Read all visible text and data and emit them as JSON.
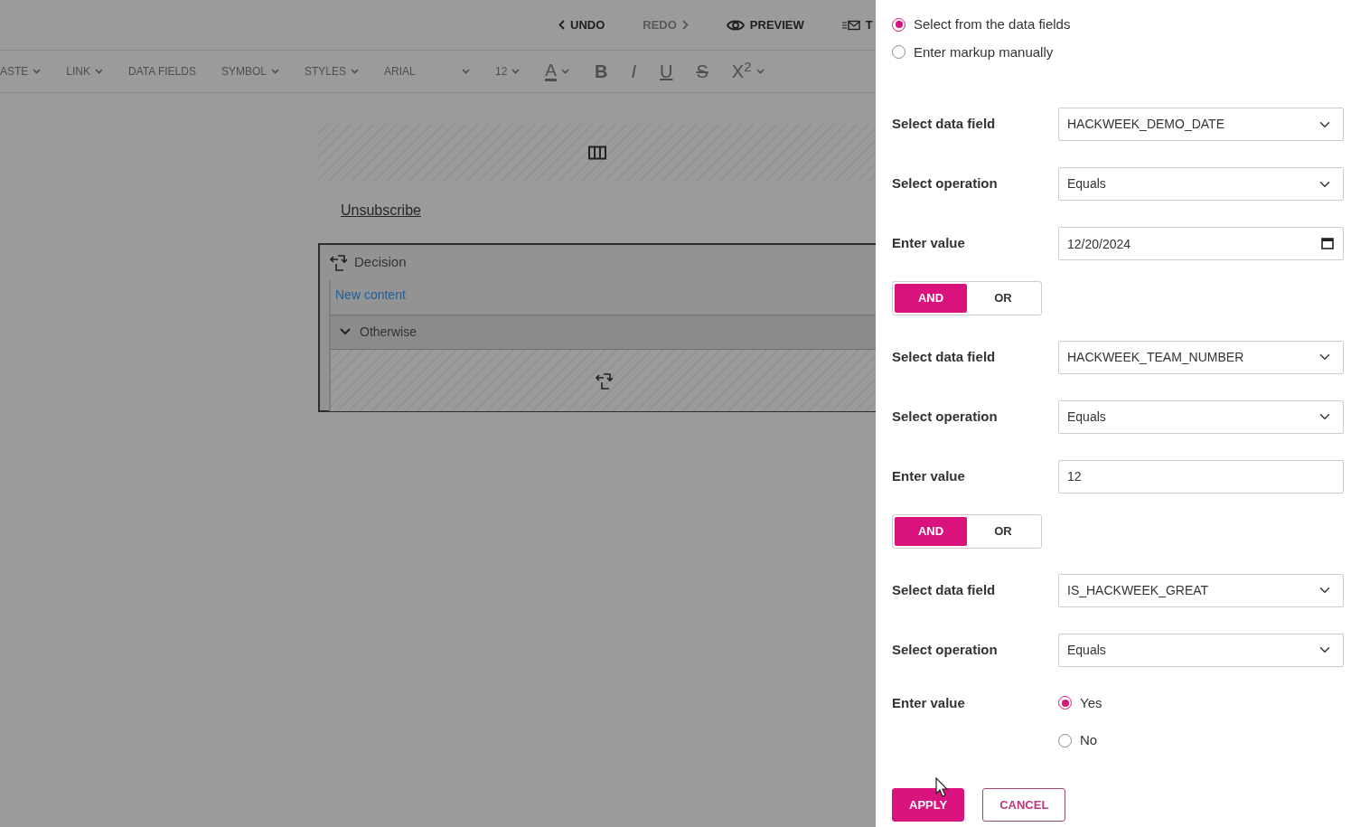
{
  "editor": {
    "history": [
      {
        "kind": "undo",
        "label": "UNDO",
        "disabled": false
      },
      {
        "kind": "redo",
        "label": "REDO",
        "disabled": true
      },
      {
        "kind": "preview",
        "label": "PREVIEW",
        "disabled": false
      },
      {
        "kind": "template",
        "label": "T",
        "disabled": false
      }
    ],
    "toolbar": [
      {
        "kind": "menu",
        "label": "ASTE"
      },
      {
        "kind": "menu",
        "label": "LINK"
      },
      {
        "kind": "plain",
        "label": "DATA FIELDS"
      },
      {
        "kind": "menu",
        "label": "SYMBOL"
      },
      {
        "kind": "menu",
        "label": "STYLES"
      },
      {
        "kind": "font",
        "label": "ARIAL"
      },
      {
        "kind": "menu",
        "label": "12"
      },
      {
        "kind": "color",
        "label": "A"
      },
      {
        "kind": "bold",
        "label": "B"
      },
      {
        "kind": "italic",
        "label": "I"
      },
      {
        "kind": "underline",
        "label": "U"
      },
      {
        "kind": "strike",
        "label": "S"
      },
      {
        "kind": "sup",
        "label": "X$^{2}$"
      }
    ],
    "link": "Unsubscribe",
    "decision": {
      "title": "Decision",
      "content": "New content",
      "otherwise": "Otherwise"
    }
  },
  "panel": {
    "modes": [
      {
        "label": "Select from the data fields",
        "selected": true
      },
      {
        "label": "Enter markup manually",
        "selected": false
      }
    ],
    "conditions": [
      {
        "field_label": "Select data field",
        "field": "HACKWEEK_DEMO_DATE",
        "operation_label": "Select operation",
        "operation": "Equals",
        "value_label": "Enter value",
        "kind": "date",
        "value": "12/20/2024",
        "connector": [
          {
            "label": "AND",
            "selected": true
          },
          {
            "label": "OR",
            "selected": false
          }
        ]
      },
      {
        "field_label": "Select data field",
        "field": "HACKWEEK_TEAM_NUMBER",
        "operation_label": "Select operation",
        "operation": "Equals",
        "value_label": "Enter value",
        "kind": "text",
        "value": "12",
        "connector": [
          {
            "label": "AND",
            "selected": true
          },
          {
            "label": "OR",
            "selected": false
          }
        ]
      },
      {
        "field_label": "Select data field",
        "field": "IS_HACKWEEK_GREAT",
        "operation_label": "Select operation",
        "operation": "Equals",
        "value_label": "Enter value",
        "kind": "choice",
        "choices": [
          {
            "label": "Yes",
            "selected": true
          },
          {
            "label": "No",
            "selected": false
          }
        ]
      }
    ],
    "buttons": [
      {
        "kind": "primary",
        "label": "APPLY"
      },
      {
        "kind": "secondary",
        "label": "CANCEL"
      }
    ]
  }
}
